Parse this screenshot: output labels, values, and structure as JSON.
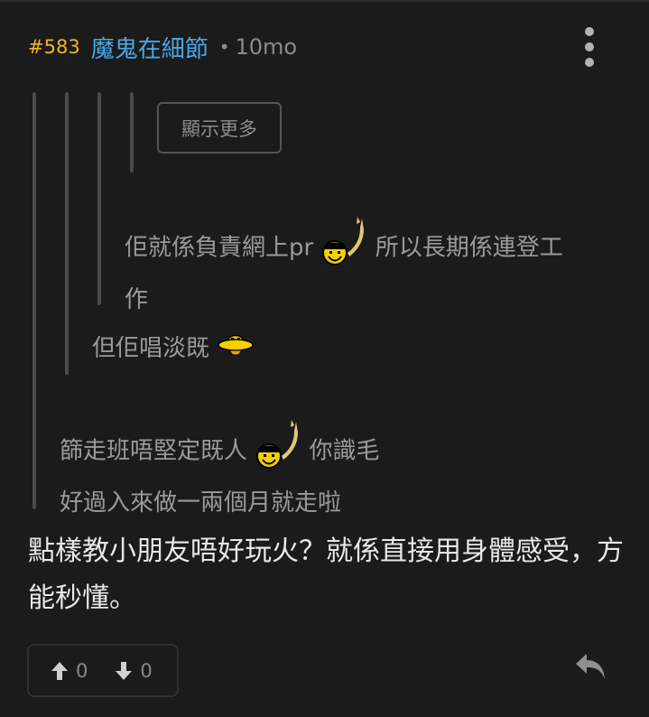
{
  "post": {
    "number": "#583",
    "username": "魔鬼在細節",
    "separator": "•",
    "time": "10mo"
  },
  "quotes": {
    "show_more_label": "顯示更多",
    "level3": {
      "line1_a": "佢就係負責網上pr",
      "line1_b": "所以長期係連登工",
      "line2": "作"
    },
    "level2": {
      "text": "但佢唱淡既"
    },
    "level1": {
      "line1_a": "篩走班唔堅定既人",
      "line1_b": "你識毛",
      "line2": "好過入來做一兩個月就走啦"
    }
  },
  "main": {
    "text": "點樣教小朋友唔好玩火？就係直接用身體感受，方能秒懂。"
  },
  "votes": {
    "up_count": "0",
    "down_count": "0"
  },
  "icons": {
    "more": "more-vertical-icon",
    "upvote": "arrow-up-icon",
    "downvote": "arrow-down-icon",
    "reply": "reply-icon",
    "emoji_devil": "devil-horns-emoji",
    "emoji_ufo": "ufo-emoji"
  },
  "colors": {
    "background": "#1b1b1b",
    "post_number": "#f0b429",
    "username": "#4aa8e8",
    "quote_text": "#9a9a9a",
    "main_text": "#e8e8e8"
  }
}
